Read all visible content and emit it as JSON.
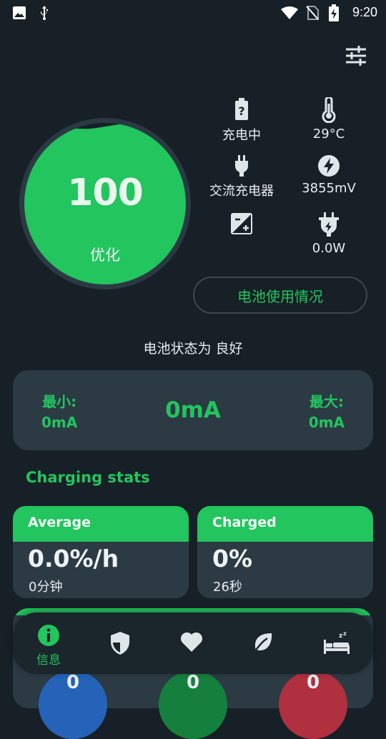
{
  "status_bar": {
    "time": "9:20"
  },
  "gauge": {
    "value": "100",
    "label": "优化",
    "accent": "#22c55e"
  },
  "info": {
    "charge_status": "充电中",
    "temperature": "29°C",
    "power_source": "交流充电器",
    "voltage": "3855mV",
    "wattage": "0.0W"
  },
  "usage_button": "电池使用情况",
  "health": "电池状态为 良好",
  "current": {
    "min_label": "最小:",
    "min_value": "0mA",
    "now_value": "0mA",
    "max_label": "最大:",
    "max_value": "0mA"
  },
  "charging_stats": {
    "title": "Charging stats",
    "average": {
      "label": "Average",
      "value": "0.0%/h",
      "sub": "0分钟"
    },
    "charged": {
      "label": "Charged",
      "value": "0%",
      "sub": "26秒"
    }
  },
  "bottom_stats": [
    "0",
    "0",
    "0"
  ],
  "nav": {
    "info_label": "信息"
  },
  "colors": {
    "accent": "#22c55e",
    "background": "#162026",
    "card": "#2c3a44"
  }
}
